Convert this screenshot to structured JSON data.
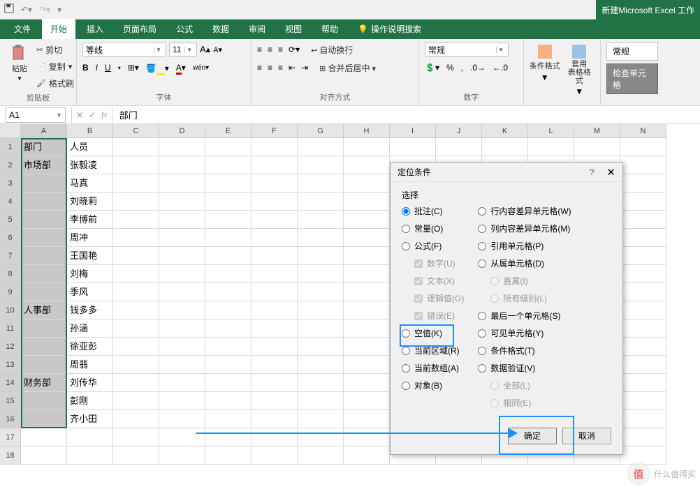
{
  "app_title": "新建Microsoft Excel 工作",
  "qat": {
    "save": "保存",
    "undo": "撤销",
    "redo": "重做"
  },
  "tabs": {
    "file": "文件",
    "home": "开始",
    "insert": "插入",
    "layout": "页面布局",
    "formulas": "公式",
    "data": "数据",
    "review": "审阅",
    "view": "视图",
    "help": "帮助",
    "tell": "操作说明搜索"
  },
  "ribbon": {
    "clipboard": {
      "paste": "粘贴",
      "cut": "剪切",
      "copy": "复制",
      "format_painter": "格式刷",
      "label": "剪贴板"
    },
    "font": {
      "name": "等线",
      "size": "11",
      "label": "字体",
      "bold": "B",
      "italic": "I",
      "underline": "U"
    },
    "align": {
      "wrap": "自动换行",
      "merge": "合并后居中",
      "label": "对齐方式"
    },
    "number": {
      "format": "常规",
      "label": "数字"
    },
    "styles": {
      "cond": "条件格式",
      "table": "套用\n表格格式",
      "normal": "常规",
      "check": "检查单元格"
    }
  },
  "namebox": "A1",
  "formula": "部门",
  "columns": [
    "A",
    "B",
    "C",
    "D",
    "E",
    "F",
    "G",
    "H",
    "I",
    "J",
    "K",
    "L",
    "M",
    "N"
  ],
  "rows": [
    {
      "n": "1",
      "A": "部门",
      "B": "人员"
    },
    {
      "n": "2",
      "A": "市场部",
      "B": "张毅凌"
    },
    {
      "n": "3",
      "A": "",
      "B": "马真"
    },
    {
      "n": "4",
      "A": "",
      "B": "刘晓莉"
    },
    {
      "n": "5",
      "A": "",
      "B": "李博前"
    },
    {
      "n": "6",
      "A": "",
      "B": "周冲"
    },
    {
      "n": "7",
      "A": "",
      "B": "王国艳"
    },
    {
      "n": "8",
      "A": "",
      "B": "刘梅"
    },
    {
      "n": "9",
      "A": "",
      "B": "季风"
    },
    {
      "n": "10",
      "A": "人事部",
      "B": "钱多多"
    },
    {
      "n": "11",
      "A": "",
      "B": "孙涵"
    },
    {
      "n": "12",
      "A": "",
      "B": "徐亚彭"
    },
    {
      "n": "13",
      "A": "",
      "B": "周翡"
    },
    {
      "n": "14",
      "A": "财务部",
      "B": "刘传华"
    },
    {
      "n": "15",
      "A": "",
      "B": "彭刚"
    },
    {
      "n": "16",
      "A": "",
      "B": "齐小田"
    },
    {
      "n": "17",
      "A": "",
      "B": ""
    },
    {
      "n": "18",
      "A": "",
      "B": ""
    }
  ],
  "dialog": {
    "title": "定位条件",
    "select": "选择",
    "left": [
      {
        "id": "comments",
        "label": "批注(C)",
        "type": "radio",
        "checked": true
      },
      {
        "id": "constants",
        "label": "常量(O)",
        "type": "radio"
      },
      {
        "id": "formulas",
        "label": "公式(F)",
        "type": "radio"
      },
      {
        "id": "numbers",
        "label": "数字(U)",
        "type": "check",
        "ind": true,
        "dis": true,
        "checked": true
      },
      {
        "id": "text",
        "label": "文本(X)",
        "type": "check",
        "ind": true,
        "dis": true,
        "checked": true
      },
      {
        "id": "logicals",
        "label": "逻辑值(G)",
        "type": "check",
        "ind": true,
        "dis": true,
        "checked": true
      },
      {
        "id": "errors",
        "label": "错误(E)",
        "type": "check",
        "ind": true,
        "dis": true,
        "checked": true
      },
      {
        "id": "blanks",
        "label": "空值(K)",
        "type": "radio",
        "hl": true
      },
      {
        "id": "region",
        "label": "当前区域(R)",
        "type": "radio"
      },
      {
        "id": "array",
        "label": "当前数组(A)",
        "type": "radio"
      },
      {
        "id": "objects",
        "label": "对象(B)",
        "type": "radio"
      }
    ],
    "right": [
      {
        "id": "rowdiff",
        "label": "行内容差异单元格(W)",
        "type": "radio"
      },
      {
        "id": "coldiff",
        "label": "列内容差异单元格(M)",
        "type": "radio"
      },
      {
        "id": "precedents",
        "label": "引用单元格(P)",
        "type": "radio"
      },
      {
        "id": "dependents",
        "label": "从属单元格(D)",
        "type": "radio"
      },
      {
        "id": "direct",
        "label": "直属(I)",
        "type": "radio",
        "ind": true,
        "dis": true
      },
      {
        "id": "all-levels",
        "label": "所有级别(L)",
        "type": "radio",
        "ind": true,
        "dis": true
      },
      {
        "id": "last",
        "label": "最后一个单元格(S)",
        "type": "radio"
      },
      {
        "id": "visible",
        "label": "可见单元格(Y)",
        "type": "radio"
      },
      {
        "id": "condfmt",
        "label": "条件格式(T)",
        "type": "radio"
      },
      {
        "id": "datavalid",
        "label": "数据验证(V)",
        "type": "radio"
      },
      {
        "id": "all",
        "label": "全部(L)",
        "type": "radio",
        "ind": true,
        "dis": true
      },
      {
        "id": "same",
        "label": "相同(E)",
        "type": "radio",
        "ind": true,
        "dis": true
      }
    ],
    "ok": "确定",
    "cancel": "取消",
    "help": "?",
    "close": "✕"
  },
  "watermark": {
    "logo": "值",
    "text": "什么值得买"
  }
}
